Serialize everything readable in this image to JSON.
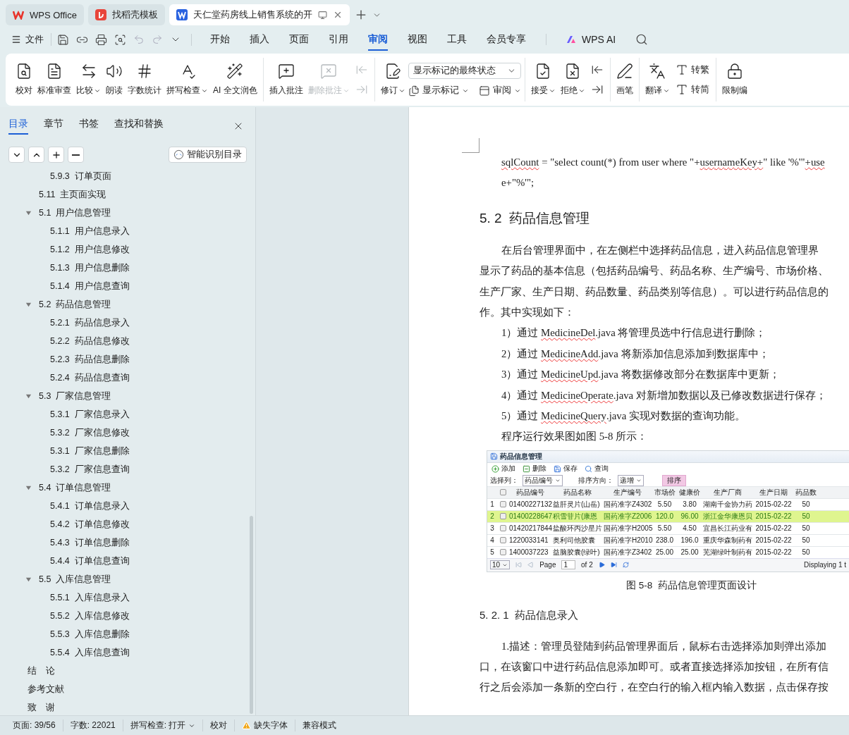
{
  "title_tabs": [
    {
      "label": "WPS Office",
      "selected": false,
      "kind": "home"
    },
    {
      "label": "找稻壳模板",
      "selected": false,
      "kind": "template"
    },
    {
      "label": "天仁堂药房线上销售系统的开",
      "selected": true,
      "kind": "document"
    }
  ],
  "menu": {
    "file": "文件",
    "tabs": [
      {
        "label": "开始",
        "selected": false
      },
      {
        "label": "插入",
        "selected": false
      },
      {
        "label": "页面",
        "selected": false
      },
      {
        "label": "引用",
        "selected": false
      },
      {
        "label": "审阅",
        "selected": true
      },
      {
        "label": "视图",
        "selected": false
      },
      {
        "label": "工具",
        "selected": false
      },
      {
        "label": "会员专享",
        "selected": false
      }
    ],
    "ai": "WPS AI"
  },
  "ribbon": [
    {
      "items": [
        {
          "kind": "large",
          "label": "校对"
        },
        {
          "kind": "large",
          "label": "标准审查"
        },
        {
          "kind": "large",
          "label": "比较",
          "dropdown": true
        },
        {
          "kind": "large",
          "label": "朗读"
        },
        {
          "kind": "large",
          "label": "字数统计"
        },
        {
          "kind": "large",
          "label": "拼写检查",
          "dropdown": true
        },
        {
          "kind": "large",
          "label": "AI 全文润色"
        }
      ]
    },
    {
      "items": [
        {
          "kind": "large",
          "label": "插入批注"
        },
        {
          "kind": "large",
          "label": "删除批注",
          "dropdown": true,
          "disabled": true
        },
        {
          "kind": "stack",
          "buttons": [
            {
              "disabled": true
            },
            {
              "disabled": true
            }
          ]
        }
      ]
    },
    {
      "items": [
        {
          "kind": "large",
          "label": "修订",
          "dropdown": true
        },
        {
          "kind": "panel",
          "select": "显示标记的最终状态",
          "buttons": [
            {
              "label": "显示标记",
              "dropdown": true
            },
            {
              "label": "审阅",
              "dropdown": true
            }
          ]
        }
      ]
    },
    {
      "items": [
        {
          "kind": "large",
          "label": "接受",
          "dropdown": true
        },
        {
          "kind": "large",
          "label": "拒绝",
          "dropdown": true
        },
        {
          "kind": "stack",
          "buttons": [
            {
              "disabled": false
            },
            {
              "disabled": false
            }
          ]
        }
      ]
    },
    {
      "items": [
        {
          "kind": "large",
          "label": "画笔"
        }
      ]
    },
    {
      "items": [
        {
          "kind": "large",
          "label": "翻译",
          "dropdown": true
        },
        {
          "kind": "stack",
          "buttons": [
            {
              "label": "转繁"
            },
            {
              "label": "转简"
            }
          ]
        }
      ]
    },
    {
      "items": [
        {
          "kind": "large",
          "label": "限制编"
        }
      ]
    }
  ],
  "sidebar": {
    "tabs": [
      {
        "label": "目录",
        "selected": true
      },
      {
        "label": "章节",
        "selected": false
      },
      {
        "label": "书签",
        "selected": false
      },
      {
        "label": "查找和替换",
        "selected": false
      }
    ],
    "smart_button": "智能识别目录",
    "toc": [
      {
        "children": [
          {
            "children": [
              {
                "label": "5.9.3  订单页面"
              }
            ]
          },
          {
            "label": "5.11  主页面实现"
          },
          {
            "label": "5.1  用户信息管理",
            "expanded": true,
            "children": [
              {
                "label": "5.1.1  用户信息录入"
              },
              {
                "label": "5.1.2  用户信息修改"
              },
              {
                "label": "5.1.3  用户信息删除"
              },
              {
                "label": "5.1.4  用户信息查询"
              }
            ]
          },
          {
            "label": "5.2  药品信息管理",
            "expanded": true,
            "children": [
              {
                "label": "5.2.1  药品信息录入"
              },
              {
                "label": "5.2.2  药品信息修改"
              },
              {
                "label": "5.2.3  药品信息删除"
              },
              {
                "label": "5.2.4  药品信息查询"
              }
            ]
          },
          {
            "label": "5.3  厂家信息管理",
            "expanded": true,
            "children": [
              {
                "label": "5.3.1  厂家信息录入"
              },
              {
                "label": "5.3.2  厂家信息修改"
              },
              {
                "label": "5.3.1  厂家信息删除"
              },
              {
                "label": "5.3.2  厂家信息查询"
              }
            ]
          },
          {
            "label": "5.4  订单信息管理",
            "expanded": true,
            "children": [
              {
                "label": "5.4.1  订单信息录入"
              },
              {
                "label": "5.4.2  订单信息修改"
              },
              {
                "label": "5.4.3  订单信息删除"
              },
              {
                "label": "5.4.4  订单信息查询"
              }
            ]
          },
          {
            "label": "5.5  入库信息管理",
            "expanded": true,
            "children": [
              {
                "label": "5.5.1  入库信息录入"
              },
              {
                "label": "5.5.2  入库信息修改"
              },
              {
                "label": "5.5.3  入库信息删除"
              },
              {
                "label": "5.5.4  入库信息查询"
              }
            ]
          }
        ]
      },
      {
        "label": "结　论"
      },
      {
        "label": "参考文献"
      },
      {
        "label": "致　谢"
      }
    ]
  },
  "document": {
    "blocks": [
      {
        "kind": "code",
        "lines": [
          {
            "indent": true,
            "segments": [
              {
                "text": "sqlCount",
                "flagged": true
              },
              {
                "text": " = \"select count(*) from user where \"+"
              },
              {
                "text": "usernameKey+",
                "flagged": true
              },
              {
                "text": "\" like '%'\""
              },
              {
                "text": "+use",
                "flagged": true
              }
            ]
          },
          {
            "indent": true,
            "segments": [
              {
                "text": "e+\"%'\";"
              }
            ]
          }
        ]
      },
      {
        "kind": "heading",
        "text": "5. 2  药品信息管理"
      },
      {
        "kind": "para",
        "lines": [
          {
            "indent": true,
            "text": "在后台管理界面中，在左侧栏中选择药品信息，进入药品信息管理界"
          },
          {
            "text": "显示了药品的基本信息（包括药品编号、药品名称、生产编号、市场价格、"
          },
          {
            "text": "生产厂家、生产日期、药品数量、药品类别等信息）。可以进行药品信息的"
          },
          {
            "text": "作。其中实现如下："
          },
          {
            "indent": true,
            "segments": [
              {
                "text": "1）通过 "
              },
              {
                "text": "MedicineDel",
                "flagged": true
              },
              {
                "text": ".java 将管理员选中行信息进行删除；"
              }
            ]
          },
          {
            "indent": true,
            "segments": [
              {
                "text": "2）通过 "
              },
              {
                "text": "MedicineAdd",
                "flagged": true
              },
              {
                "text": ".java 将新添加信息添加到数据库中；"
              }
            ]
          },
          {
            "indent": true,
            "segments": [
              {
                "text": "3）通过 "
              },
              {
                "text": "MedicineUpd",
                "flagged": true
              },
              {
                "text": ".java 将数据修改部分在数据库中更新；"
              }
            ]
          },
          {
            "indent": true,
            "segments": [
              {
                "text": "4）通过 "
              },
              {
                "text": "MedicineOperate",
                "flagged": true
              },
              {
                "text": ".java 对新增加数据以及已修改数据进行保存；"
              }
            ]
          },
          {
            "indent": true,
            "segments": [
              {
                "text": "5）通过 "
              },
              {
                "text": "MedicineQuery",
                "flagged": true
              },
              {
                "text": ".java 实现对数据的查询功能。"
              }
            ]
          },
          {
            "indent": true,
            "text": "程序运行效果图如图 5-8 所示："
          }
        ]
      },
      {
        "kind": "figure",
        "title": "药品信息管理",
        "toolbar": [
          "添加",
          "删除",
          "保存",
          "查询"
        ],
        "filter": {
          "column_label": "选择列：",
          "column_value": "药品编号",
          "order_label": "排序方向：",
          "order_value": "递增",
          "button": "排序"
        },
        "all_checked": false,
        "columns": [
          "药品编号",
          "药品名称",
          "生产编号",
          "市场价",
          "健康价",
          "生产厂商",
          "生产日期",
          "药品数"
        ],
        "rows": [
          {
            "number": "1",
            "selected": false,
            "checked": false,
            "cells": [
              "01400227132",
              "益肝灵片(山岳)",
              "国药准字Z4302",
              "5.50",
              "3.80",
              "湖南千金协力药",
              "2015-02-22",
              "50"
            ]
          },
          {
            "number": "2",
            "selected": true,
            "checked": false,
            "cells": [
              "01400228647",
              "积雪苷片(康恩",
              "国药准字Z2006",
              "120.0",
              "96.00",
              "浙江金华康恩贝",
              "2015-02-22",
              "50"
            ]
          },
          {
            "number": "3",
            "selected": false,
            "checked": false,
            "cells": [
              "01420217844",
              "盐酸环丙沙星片",
              "国药准字H2005",
              "5.50",
              "4.50",
              "宜昌长江药业有",
              "2015-02-22",
              "50"
            ]
          },
          {
            "number": "4",
            "selected": false,
            "checked": false,
            "cells": [
              "1220033141",
              "奥利司他胶囊",
              "国药准字H2010",
              "238.0",
              "196.0",
              "重庆华森制药有",
              "2015-02-22",
              "50"
            ]
          },
          {
            "number": "5",
            "selected": false,
            "checked": false,
            "cells": [
              "1400037223",
              "益脑胶囊(绿叶)",
              "国药准字Z3402",
              "25.00",
              "25.00",
              "芜湖绿叶制药有",
              "2015-02-22",
              "50"
            ]
          }
        ],
        "pager": {
          "size": "10",
          "page_label": "Page",
          "page": "1",
          "of": "of 2",
          "display": "Displaying 1 t"
        }
      },
      {
        "kind": "caption",
        "text": "图 5-8  药品信息管理页面设计"
      },
      {
        "kind": "subheading",
        "text": "5. 2. 1  药品信息录入"
      },
      {
        "kind": "para",
        "lines": [
          {
            "indent": true,
            "text": "1.描述：管理员登陆到药品管理界面后，鼠标右击选择添加则弹出添加"
          },
          {
            "text": "口，在该窗口中进行药品信息添加即可。或者直接选择添加按钮，在所有信"
          },
          {
            "text": "行之后会添加一条新的空白行，在空白行的输入框内输入数据，点击保存按"
          }
        ]
      }
    ]
  },
  "status_bar": [
    {
      "kind": "text",
      "text": "页面: 39/56"
    },
    {
      "kind": "text",
      "text": "字数: 22021"
    },
    {
      "kind": "dropdown",
      "text": "拼写检查: 打开"
    },
    {
      "kind": "text",
      "text": "校对"
    },
    {
      "kind": "warning",
      "text": "缺失字体"
    },
    {
      "kind": "text",
      "text": "兼容模式"
    }
  ]
}
